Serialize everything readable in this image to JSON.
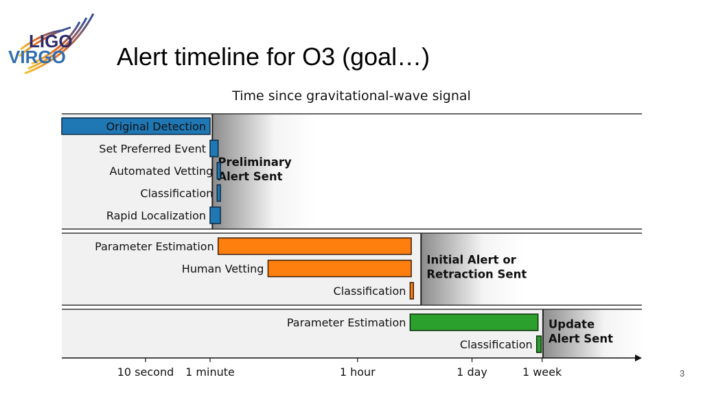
{
  "slide": {
    "title": "Alert timeline for O3 (goal…)",
    "page_number": "3",
    "logo": {
      "top_text": "LIGO",
      "bottom_text": "VIRGO"
    }
  },
  "chart_data": {
    "type": "timeline",
    "title": "Time since gravitational-wave signal",
    "x_scale": "log",
    "x_unit": "seconds",
    "xlim": [
      0.6,
      5000000
    ],
    "ticks": [
      {
        "label": "10 second",
        "value": 10
      },
      {
        "label": "1 minute",
        "value": 60
      },
      {
        "label": "1 hour",
        "value": 3600
      },
      {
        "label": "1 day",
        "value": 86400
      },
      {
        "label": "1 week",
        "value": 604800
      }
    ],
    "stages": [
      {
        "name": "preliminary",
        "alert_label": [
          "Preliminary",
          "Alert Sent"
        ],
        "alert_time": 64,
        "color": "#1f77b4",
        "tasks": [
          {
            "label": "Original Detection",
            "start": 0.6,
            "end": 60
          },
          {
            "label": "Set Preferred Event",
            "start": 60,
            "end": 75
          },
          {
            "label": "Automated Vetting",
            "start": 73,
            "end": 80
          },
          {
            "label": "Classification",
            "start": 73,
            "end": 80
          },
          {
            "label": "Rapid Localization",
            "start": 60,
            "end": 80
          }
        ]
      },
      {
        "name": "initial",
        "alert_label": [
          "Initial Alert or",
          "Retraction Sent"
        ],
        "alert_time": 21000,
        "color": "#ff7f0e",
        "tasks": [
          {
            "label": "Parameter Estimation",
            "start": 75,
            "end": 16000
          },
          {
            "label": "Human Vetting",
            "start": 300,
            "end": 16000
          },
          {
            "label": "Classification",
            "start": 15500,
            "end": 17000
          }
        ]
      },
      {
        "name": "update",
        "alert_label": [
          "Update",
          "Alert Sent"
        ],
        "alert_time": 620000,
        "color": "#2ca02c",
        "tasks": [
          {
            "label": "Parameter Estimation",
            "start": 15500,
            "end": 540000
          },
          {
            "label": "Classification",
            "start": 520000,
            "end": 590000
          }
        ]
      }
    ]
  }
}
